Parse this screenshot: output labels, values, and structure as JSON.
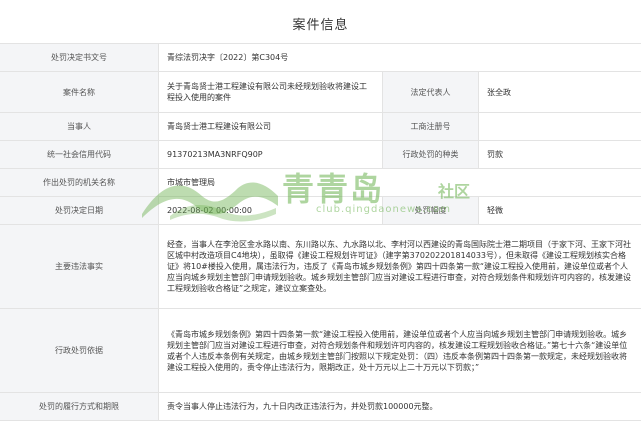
{
  "page": {
    "title": "案件信息"
  },
  "rows": {
    "decision_no": {
      "label": "处罚决定书文号",
      "value": "青综法罚决字〔2022〕第C304号"
    },
    "case_name": {
      "label": "案件名称",
      "value": "关于青岛贤士港工程建设有限公司未经规划验收将建设工程投入使用的案件",
      "label2": "法定代表人",
      "value2": "张全政"
    },
    "party": {
      "label": "当事人",
      "value": "青岛贤士港工程建设有限公司",
      "label2": "工商注册号",
      "value2": ""
    },
    "credit_code": {
      "label": "统一社会信用代码",
      "value": "91370213MA3NRFQ90P",
      "label2": "行政处罚的种类",
      "value2": "罚款"
    },
    "authority": {
      "label": "作出处罚的机关名称",
      "value": "市城市管理局"
    },
    "decision_date": {
      "label": "处罚决定日期",
      "value": "2022-08-02 00:00:00",
      "label2": "处罚幅度",
      "value2": "轻微"
    },
    "violation": {
      "label": "主要违法事实",
      "value": "经查，当事人在李沧区金水路以南、东川路以东、九水路以北、李村河以西建设的青岛国际院士港二期项目（于家下河、王家下河社区城中村改造项目C4地块），虽取得《建设工程规划许可证》（建字第370202201814033号），但未取得《建设工程规划核实合格证》将10#楼投入使用，属违法行为，违反了《青岛市城乡规划条例》第四十四条第一款“建设工程投入使用前，建设单位或者个人应当向城乡规划主管部门申请规划验收。城乡规划主管部门应当对建设工程进行审查，对符合规划条件和规划许可内容的，核发建设工程规划验收合格证”之规定，建议立案查处。"
    },
    "basis": {
      "label": "行政处罚依据",
      "value": "《青岛市城乡规划条例》第四十四条第一款“建设工程投入使用前，建设单位或者个人应当向城乡规划主管部门申请规划验收。城乡规划主管部门应当对建设工程进行审查，对符合规划条件和规划许可内容的，核发建设工程规划验收合格证。”第七十六条“建设单位或者个人违反本条例有关规定，由城乡规划主管部门按照以下规定处罚：（四）违反本条例第四十四条第一款规定，未经规划验收将建设工程投入使用的，责令停止违法行为，限期改正，处十万元以上二十万元以下罚款；”"
    },
    "performance": {
      "label": "处罚的履行方式和期限",
      "value": "责令当事人停止违法行为，九十日内改正违法行为，并处罚款100000元整。"
    }
  },
  "watermark": {
    "main": "青青岛",
    "sub": "社区",
    "url": "club.qingdaonews.com"
  }
}
